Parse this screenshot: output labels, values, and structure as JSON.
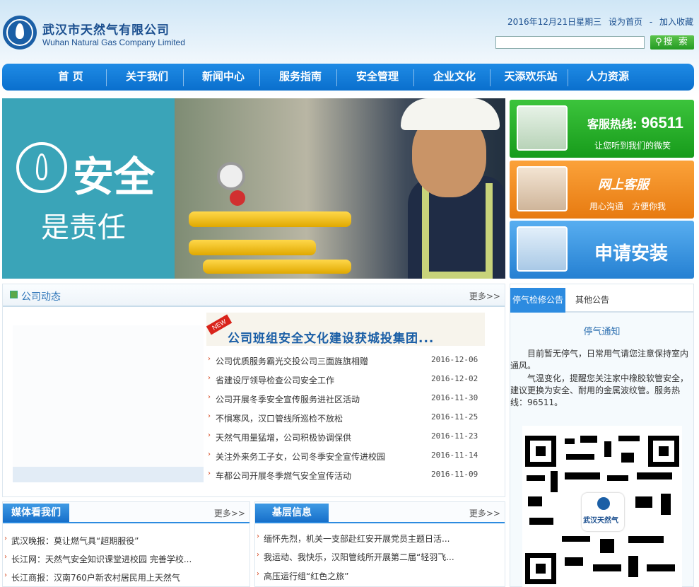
{
  "header": {
    "logo_cn": "武汉市天然气有限公司",
    "logo_en": "Wuhan Natural Gas Company Limited",
    "date": "2016年12月21日星期三",
    "set_home": "设为首页",
    "sep": "-",
    "add_fav": "加入收藏",
    "search_placeholder": "",
    "search_btn": "搜 索"
  },
  "nav": [
    "首 页",
    "关于我们",
    "新闻中心",
    "服务指南",
    "安全管理",
    "企业文化",
    "天添欢乐站",
    "人力资源"
  ],
  "banner": {
    "big": "安全",
    "small": "是责任"
  },
  "cards": {
    "hotline_label": "客服热线:",
    "hotline_num": "96511",
    "hotline_sub": "让您听到我们的微笑",
    "online_title": "网上客服",
    "online_sub": "用心沟通　方便你我",
    "apply_title": "申请安装"
  },
  "news": {
    "title": "公司动态",
    "more": "更多>>",
    "new_tag": "NEW",
    "headline": "公司班组安全文化建设获城投集团...",
    "items": [
      {
        "title": "公司优质服务霸光交投公司三面旌旗相赠",
        "date": "2016-12-06"
      },
      {
        "title": "省建设厅领导检查公司安全工作",
        "date": "2016-12-02"
      },
      {
        "title": "公司开展冬季安全宣传服务进社区活动",
        "date": "2016-11-30"
      },
      {
        "title": "不惧寒风，汉口管线所巡检不放松",
        "date": "2016-11-25"
      },
      {
        "title": "天然气用量猛增，公司积极协调保供",
        "date": "2016-11-23"
      },
      {
        "title": "关注外来务工子女，公司冬季安全宣传进校园",
        "date": "2016-11-14"
      },
      {
        "title": "车都公司开展冬季燃气安全宣传活动",
        "date": "2016-11-09"
      }
    ]
  },
  "notice": {
    "tab_active": "停气检修公告",
    "tab_other": "其他公告",
    "heading": "停气通知",
    "p1": "目前暂无停气，日常用气请您注意保持室内通风。",
    "p2": "气温变化，提醒您关注家中橡胶软管安全，建议更换为安全、耐用的金属波纹管。服务热线：96511。",
    "qr_label": "武汉天然气"
  },
  "media": {
    "title": "媒体看我们",
    "more": "更多>>",
    "items": [
      "武汉晚报：莫让燃气具“超期服役”",
      "长江网：天然气安全知识课堂进校园 完善学校...",
      "长江商报：汉南760户新农村居民用上天然气"
    ]
  },
  "base": {
    "title": "基层信息",
    "more": "更多>>",
    "items": [
      "缅怀先烈，机关一支部赴红安开展党员主题日活...",
      "我运动、我快乐，汉阳管线所开展第二届“轻羽飞...",
      "高压运行组“红色之旅”"
    ]
  },
  "icons": {
    "bullet": "›",
    "search": "search-icon"
  },
  "colors": {
    "nav": "#0a6fcd",
    "accent_green": "#239a22",
    "accent_orange": "#e77a10",
    "title_blue": "#1a5ea6"
  }
}
